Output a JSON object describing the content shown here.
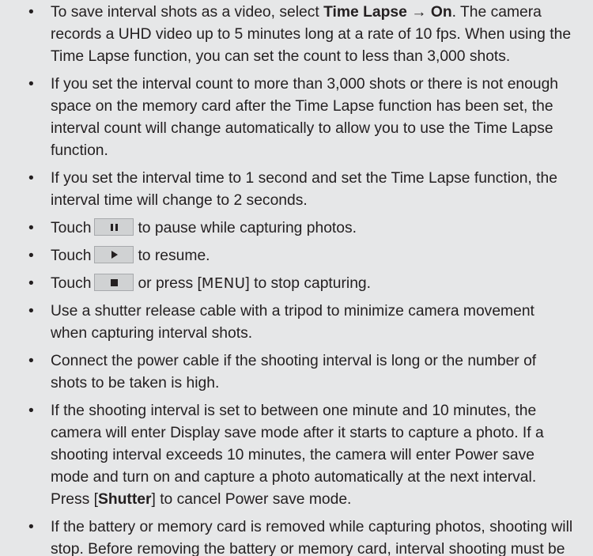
{
  "bullets": {
    "b1": {
      "t1": "To save interval shots as a video, select ",
      "bold1": "Time Lapse",
      "arrow": " → ",
      "bold2": "On",
      "t2": ". The camera records a UHD video up to 5 minutes long at a rate of 10 fps. When using the Time Lapse function, you can set the count to less than 3,000 shots."
    },
    "b2": "If you set the interval count to more than 3,000 shots or there is not enough space on the memory card after the Time Lapse function has been set, the interval count will change automatically to allow you to use the Time Lapse function.",
    "b3": "If you set the interval time to 1 second and set the Time Lapse function, the interval time will change to 2 seconds.",
    "b4": {
      "pre": "Touch",
      "post": "to pause while capturing photos.",
      "icon": "pause-icon"
    },
    "b5": {
      "pre": "Touch",
      "post": "to resume.",
      "icon": "play-icon"
    },
    "b6": {
      "pre": "Touch",
      "mid": "or press [",
      "key": "MENU",
      "post": "] to stop capturing.",
      "icon": "stop-icon"
    },
    "b7": "Use a shutter release cable with a tripod to minimize camera movement when capturing interval shots.",
    "b8": "Connect the power cable if the shooting interval is long or the number of shots to be taken is high.",
    "b9": {
      "t1": "If the shooting interval is set to between one minute and 10 minutes, the camera will enter Display save mode after it starts to capture a photo. If a shooting interval exceeds 10 minutes, the camera will enter Power save mode and turn on and capture a photo automatically at the next interval. Press [",
      "bold": "Shutter",
      "t2": "] to cancel Power save mode."
    },
    "b10": "If the battery or memory card is removed while capturing photos, shooting will stop. Before removing the battery or memory card, interval shooting must be paused and the camera must be turned off."
  },
  "bullet_char": "•",
  "colors": {
    "background": "#e6e7e8",
    "text": "#231f20",
    "button_bg": "#d0d2d3"
  }
}
